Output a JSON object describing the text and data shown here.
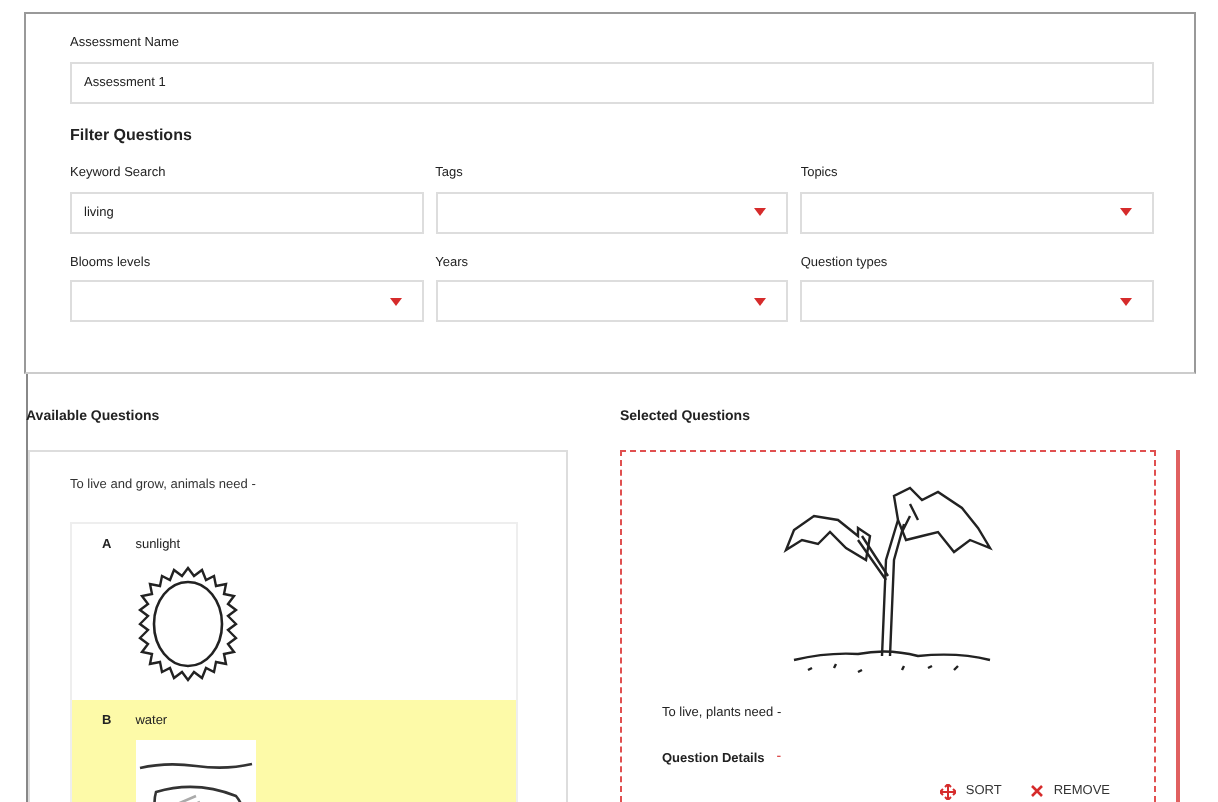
{
  "assessment_name": {
    "label": "Assessment Name",
    "value": "Assessment 1"
  },
  "filter": {
    "title": "Filter Questions",
    "fields": [
      {
        "label": "Keyword Search",
        "kind": "text",
        "value": "living"
      },
      {
        "label": "Tags",
        "kind": "select"
      },
      {
        "label": "Topics",
        "kind": "select"
      },
      {
        "label": "Blooms levels",
        "kind": "select"
      },
      {
        "label": "Years",
        "kind": "select"
      },
      {
        "label": "Question types",
        "kind": "select"
      }
    ]
  },
  "available": {
    "title": "Available Questions",
    "question": "To live and grow, animals need -",
    "options": [
      {
        "letter": "A",
        "text": "sunlight",
        "kind": "sun",
        "selected": false
      },
      {
        "letter": "B",
        "text": "water",
        "kind": "water",
        "selected": true
      }
    ]
  },
  "selected": {
    "title": "Selected Questions",
    "question": "To live, plants need -",
    "details_label": "Question Details",
    "details_toggle": "-",
    "actions": [
      {
        "label": "SORT",
        "kind": "sort"
      },
      {
        "label": "REMOVE",
        "kind": "remove"
      }
    ]
  }
}
